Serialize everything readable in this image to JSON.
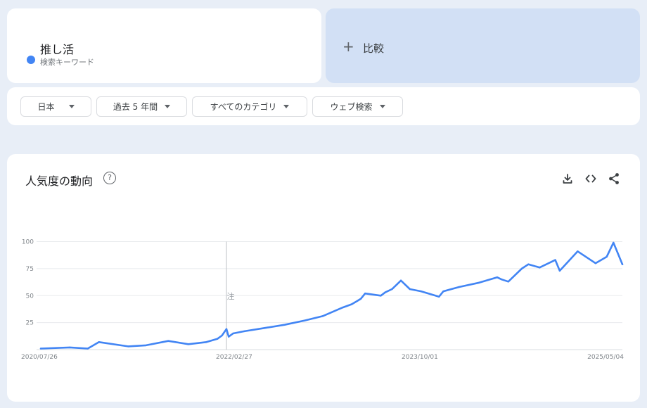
{
  "search_term": {
    "term": "推し活",
    "type_label": "検索キーワード",
    "color": "#4285f4"
  },
  "compare": {
    "plus_icon": "+",
    "label": "比較"
  },
  "filters": [
    {
      "label": "日本"
    },
    {
      "label": "過去 5 年間"
    },
    {
      "label": "すべてのカテゴリ"
    },
    {
      "label": "ウェブ検索"
    }
  ],
  "chart_panel": {
    "title": "人気度の動向",
    "help_icon": "?",
    "toolbar": [
      "download-icon",
      "embed-icon",
      "share-icon"
    ],
    "note_marker": "注"
  },
  "chart_data": {
    "type": "line",
    "title": "人気度の動向",
    "xlabel": "",
    "ylabel": "",
    "ylim": [
      0,
      100
    ],
    "yticks": [
      25,
      50,
      75,
      100
    ],
    "x_tick_labels": [
      "2020/07/26",
      "2022/02/27",
      "2023/10/01",
      "2025/05/04"
    ],
    "x_start": "2020/07/26",
    "x_end": "2025/07/20",
    "note_date": "2022/02/27",
    "grid": true,
    "series": [
      {
        "color": "#4285f4",
        "x_dates": [
          "2020/07/26",
          "2020/10/25",
          "2020/12/20",
          "2021/01/24",
          "2021/04/25",
          "2021/06/20",
          "2021/08/29",
          "2021/10/31",
          "2021/12/26",
          "2022/01/30",
          "2022/02/13",
          "2022/02/27",
          "2022/03/06",
          "2022/03/20",
          "2022/04/24",
          "2022/06/26",
          "2022/08/28",
          "2022/10/30",
          "2022/12/25",
          "2023/02/26",
          "2023/03/26",
          "2023/04/23",
          "2023/05/07",
          "2023/06/25",
          "2023/07/09",
          "2023/07/30",
          "2023/08/27",
          "2023/09/24",
          "2023/10/29",
          "2023/12/24",
          "2024/01/07",
          "2024/02/25",
          "2024/04/28",
          "2024/06/23",
          "2024/07/07",
          "2024/07/28",
          "2024/09/08",
          "2024/09/29",
          "2024/11/03",
          "2024/12/22",
          "2025/01/05",
          "2025/03/02",
          "2025/04/27",
          "2025/06/01",
          "2025/06/22",
          "2025/07/20"
        ],
        "values": [
          1,
          2,
          1,
          7,
          3,
          4,
          8,
          5,
          7,
          10,
          13,
          19,
          12,
          15,
          17,
          20,
          23,
          27,
          31,
          39,
          42,
          47,
          52,
          50,
          53,
          56,
          64,
          56,
          54,
          49,
          54,
          58,
          62,
          67,
          65,
          63,
          75,
          79,
          76,
          83,
          73,
          91,
          80,
          86,
          99,
          79
        ]
      }
    ]
  }
}
